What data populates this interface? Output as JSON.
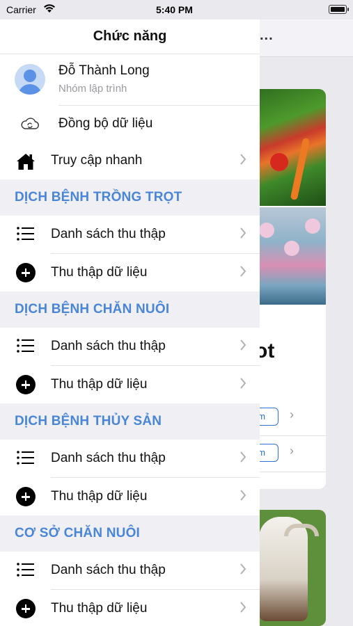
{
  "status_bar": {
    "carrier": "Carrier",
    "time": "5:40 PM",
    "battery_level": 1.0
  },
  "drawer": {
    "title": "Chức năng",
    "profile": {
      "name": "Đỗ Thành Long",
      "group": "Nhóm lập trình"
    },
    "sync_label": "Đồng bộ dữ liệu",
    "quick_access_label": "Truy cập nhanh",
    "sections": [
      {
        "title": "DỊCH BỆNH TRỒNG TRỌT",
        "items": [
          "Danh sách thu thập",
          "Thu thập dữ liệu"
        ]
      },
      {
        "title": "DỊCH BỆNH CHĂN NUÔI",
        "items": [
          "Danh sách thu thập",
          "Thu thập dữ liệu"
        ]
      },
      {
        "title": "DỊCH BỆNH THỦY SẢN",
        "items": [
          "Danh sách thu thập",
          "Thu thập dữ liệu"
        ]
      },
      {
        "title": "CƠ SỞ CHĂN NUÔI",
        "items": [
          "Danh sách thu thập",
          "Thu thập dữ liệu"
        ]
      }
    ]
  },
  "background": {
    "header_more": "...",
    "card_title_fragment": "ot",
    "button_fragment": "ềm"
  },
  "colors": {
    "section_title": "#4a86d8",
    "section_bg": "#efeff4",
    "accent": "#2f6fd6"
  }
}
